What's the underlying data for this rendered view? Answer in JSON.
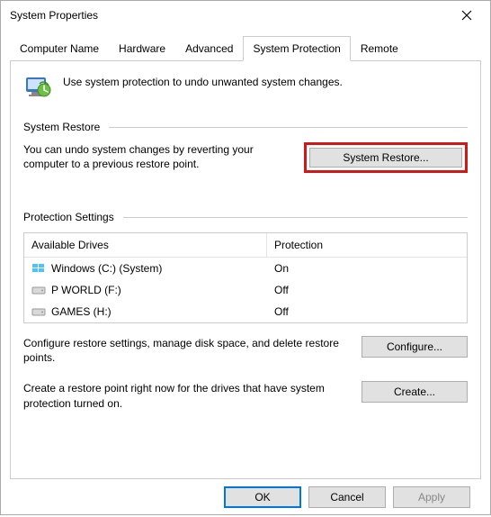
{
  "window": {
    "title": "System Properties"
  },
  "tabs": {
    "computer_name": "Computer Name",
    "hardware": "Hardware",
    "advanced": "Advanced",
    "system_protection": "System Protection",
    "remote": "Remote"
  },
  "intro": {
    "text": "Use system protection to undo unwanted system changes."
  },
  "restore": {
    "heading": "System Restore",
    "desc": "You can undo system changes by reverting your computer to a previous restore point.",
    "button": "System Restore..."
  },
  "protection": {
    "heading": "Protection Settings",
    "header_drives": "Available Drives",
    "header_protection": "Protection",
    "drives": [
      {
        "name": "Windows (C:) (System)",
        "status": "On",
        "type": "win"
      },
      {
        "name": "P WORLD (F:)",
        "status": "Off",
        "type": "hdd"
      },
      {
        "name": "GAMES (H:)",
        "status": "Off",
        "type": "hdd"
      }
    ],
    "configure_desc": "Configure restore settings, manage disk space, and delete restore points.",
    "configure_button": "Configure...",
    "create_desc": "Create a restore point right now for the drives that have system protection turned on.",
    "create_button": "Create..."
  },
  "footer": {
    "ok": "OK",
    "cancel": "Cancel",
    "apply": "Apply"
  }
}
